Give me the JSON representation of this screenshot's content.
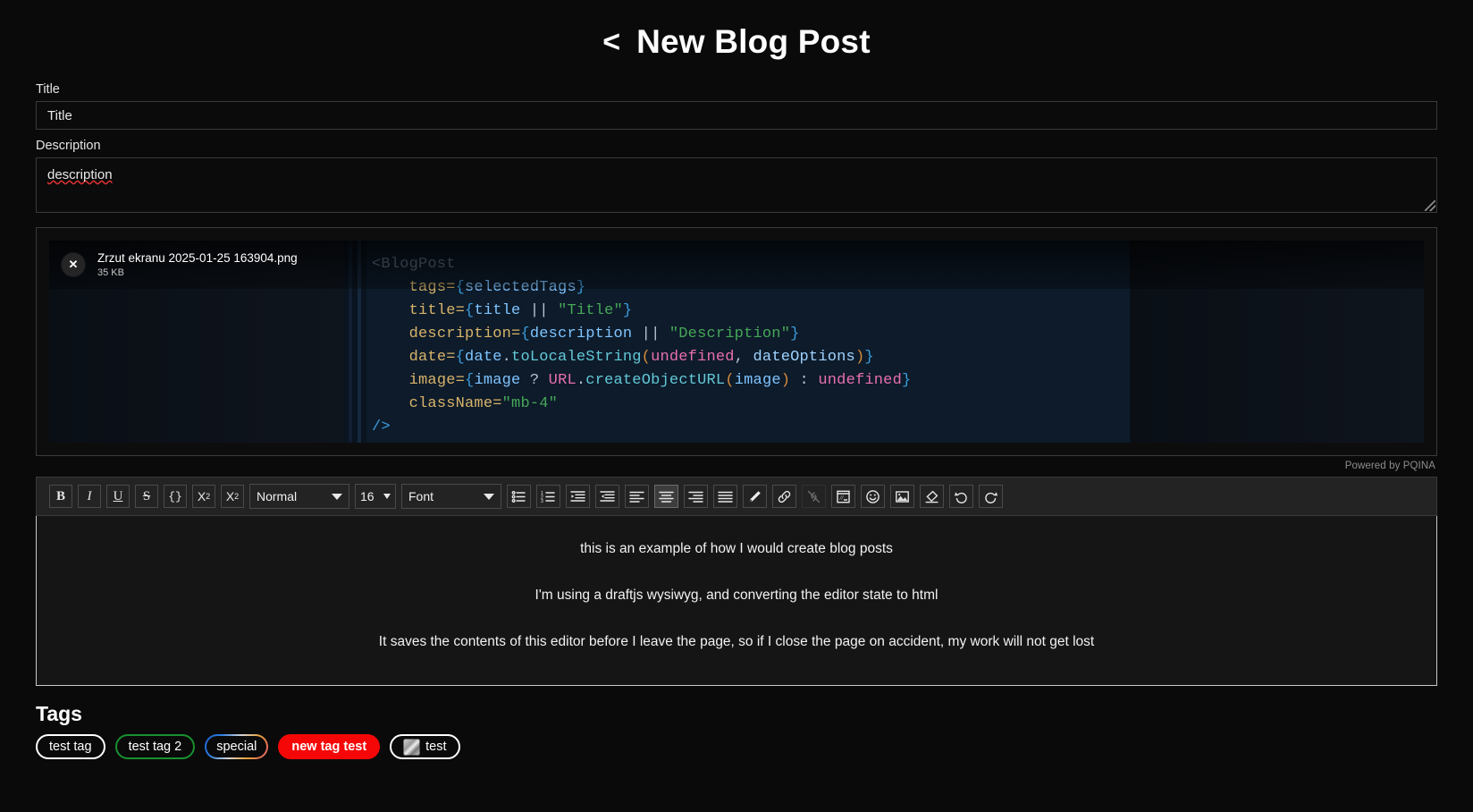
{
  "header": {
    "back_icon": "chevron-left-icon",
    "back_label": "<",
    "title": "New Blog Post"
  },
  "form": {
    "title_label": "Title",
    "title_value": "Title",
    "title_placeholder": "Title",
    "description_label": "Description",
    "description_value": "description",
    "description_placeholder": "Description"
  },
  "upload": {
    "file_name": "Zrzut ekranu 2025-01-25 163904.png",
    "file_size": "35 KB",
    "remove_label": "✕",
    "credit": "Powered by PQINA",
    "preview_code": [
      {
        "indent": 0,
        "parts": [
          {
            "t": "<BlogPost",
            "c": "c-tag"
          }
        ]
      },
      {
        "indent": 1,
        "parts": [
          {
            "t": "tags=",
            "c": "c-attr"
          },
          {
            "t": "{",
            "c": "c-brace"
          },
          {
            "t": "selectedTags",
            "c": "c-var"
          },
          {
            "t": "}",
            "c": "c-brace"
          }
        ]
      },
      {
        "indent": 1,
        "parts": [
          {
            "t": "title=",
            "c": "c-attr"
          },
          {
            "t": "{",
            "c": "c-brace"
          },
          {
            "t": "title",
            "c": "c-var"
          },
          {
            "t": " || ",
            "c": "c-plain"
          },
          {
            "t": "\"Title\"",
            "c": "c-str"
          },
          {
            "t": "}",
            "c": "c-brace"
          }
        ]
      },
      {
        "indent": 1,
        "parts": [
          {
            "t": "description=",
            "c": "c-attr"
          },
          {
            "t": "{",
            "c": "c-brace"
          },
          {
            "t": "description",
            "c": "c-var"
          },
          {
            "t": " || ",
            "c": "c-plain"
          },
          {
            "t": "\"Description\"",
            "c": "c-str"
          },
          {
            "t": "}",
            "c": "c-brace"
          }
        ]
      },
      {
        "indent": 1,
        "parts": [
          {
            "t": "date=",
            "c": "c-attr"
          },
          {
            "t": "{",
            "c": "c-brace"
          },
          {
            "t": "date",
            "c": "c-var"
          },
          {
            "t": ".",
            "c": "c-plain"
          },
          {
            "t": "toLocaleString",
            "c": "c-fn"
          },
          {
            "t": "(",
            "c": "c-paren"
          },
          {
            "t": "undefined",
            "c": "c-kw"
          },
          {
            "t": ", ",
            "c": "c-plain"
          },
          {
            "t": "dateOptions",
            "c": "c-prop"
          },
          {
            "t": ")",
            "c": "c-paren"
          },
          {
            "t": "}",
            "c": "c-brace"
          }
        ]
      },
      {
        "indent": 1,
        "parts": [
          {
            "t": "image=",
            "c": "c-attr"
          },
          {
            "t": "{",
            "c": "c-brace"
          },
          {
            "t": "image",
            "c": "c-var"
          },
          {
            "t": " ? ",
            "c": "c-plain"
          },
          {
            "t": "URL",
            "c": "c-kw"
          },
          {
            "t": ".",
            "c": "c-plain"
          },
          {
            "t": "createObjectURL",
            "c": "c-fn"
          },
          {
            "t": "(",
            "c": "c-paren"
          },
          {
            "t": "image",
            "c": "c-var"
          },
          {
            "t": ")",
            "c": "c-paren"
          },
          {
            "t": " : ",
            "c": "c-plain"
          },
          {
            "t": "undefined",
            "c": "c-kw"
          },
          {
            "t": "}",
            "c": "c-brace"
          }
        ]
      },
      {
        "indent": 1,
        "parts": [
          {
            "t": "className=",
            "c": "c-attr"
          },
          {
            "t": "\"mb-4\"",
            "c": "c-str"
          }
        ]
      },
      {
        "indent": 0,
        "parts": [
          {
            "t": "/>",
            "c": "c-brace"
          }
        ]
      }
    ]
  },
  "toolbar": {
    "buttons": [
      {
        "name": "bold-button",
        "glyph": "B",
        "style": "tb-bold",
        "active": false,
        "dim": false
      },
      {
        "name": "italic-button",
        "glyph": "I",
        "style": "tb-italic",
        "active": false,
        "dim": false
      },
      {
        "name": "underline-button",
        "glyph": "U",
        "style": "tb-underline",
        "active": false,
        "dim": false
      },
      {
        "name": "strikethrough-button",
        "glyph": "S",
        "style": "tb-strike",
        "active": false,
        "dim": false
      },
      {
        "name": "code-block-button",
        "glyph": "{}",
        "style": "tb-mono",
        "active": false,
        "dim": false
      }
    ],
    "superscript_label": "X",
    "superscript_sup": "2",
    "subscript_label": "X",
    "subscript_sub": "2",
    "block_type": "Normal",
    "font_size": "16",
    "font_family": "Font",
    "icon_buttons": [
      {
        "name": "unordered-list-icon",
        "icon": "ul",
        "active": false,
        "dim": false
      },
      {
        "name": "ordered-list-icon",
        "icon": "ol",
        "active": false,
        "dim": false
      },
      {
        "name": "indent-icon",
        "icon": "indent",
        "active": false,
        "dim": false
      },
      {
        "name": "outdent-icon",
        "icon": "outdent",
        "active": false,
        "dim": false
      },
      {
        "name": "align-left-icon",
        "icon": "align-left",
        "active": false,
        "dim": false
      },
      {
        "name": "align-center-icon",
        "icon": "align-center",
        "active": true,
        "dim": false
      },
      {
        "name": "align-right-icon",
        "icon": "align-right",
        "active": false,
        "dim": false
      },
      {
        "name": "align-justify-icon",
        "icon": "align-justify",
        "active": false,
        "dim": false
      },
      {
        "name": "text-color-icon",
        "icon": "pen",
        "active": false,
        "dim": false
      },
      {
        "name": "link-icon",
        "icon": "link",
        "active": false,
        "dim": false
      },
      {
        "name": "unlink-icon",
        "icon": "unlink",
        "active": false,
        "dim": true
      },
      {
        "name": "embedded-media-icon",
        "icon": "embed",
        "active": false,
        "dim": false
      },
      {
        "name": "emoji-icon",
        "icon": "emoji",
        "active": false,
        "dim": false
      },
      {
        "name": "image-icon",
        "icon": "image",
        "active": false,
        "dim": false
      },
      {
        "name": "remove-format-icon",
        "icon": "eraser",
        "active": false,
        "dim": false
      },
      {
        "name": "undo-icon",
        "icon": "undo",
        "active": false,
        "dim": false
      },
      {
        "name": "redo-icon",
        "icon": "redo",
        "active": false,
        "dim": false
      }
    ]
  },
  "editor": {
    "paragraphs": [
      "this is an example of how I would create blog posts",
      "I'm using a draftjs wysiwyg, and converting the editor state to html",
      "It saves the contents of this editor before I leave the page, so if I close the page on accident, my work will not get lost"
    ]
  },
  "tags": {
    "heading": "Tags",
    "items": [
      {
        "label": "test tag",
        "kind": "outline",
        "color": "#ffffff"
      },
      {
        "label": "test tag 2",
        "kind": "outline",
        "color": "#17912f"
      },
      {
        "label": "special",
        "kind": "gradient",
        "color": "#2b7de0"
      },
      {
        "label": "new tag test",
        "kind": "filled",
        "color": "#f50707"
      },
      {
        "label": "test",
        "kind": "outline",
        "color": "#ffffff",
        "icon": "building-emoji"
      }
    ]
  }
}
